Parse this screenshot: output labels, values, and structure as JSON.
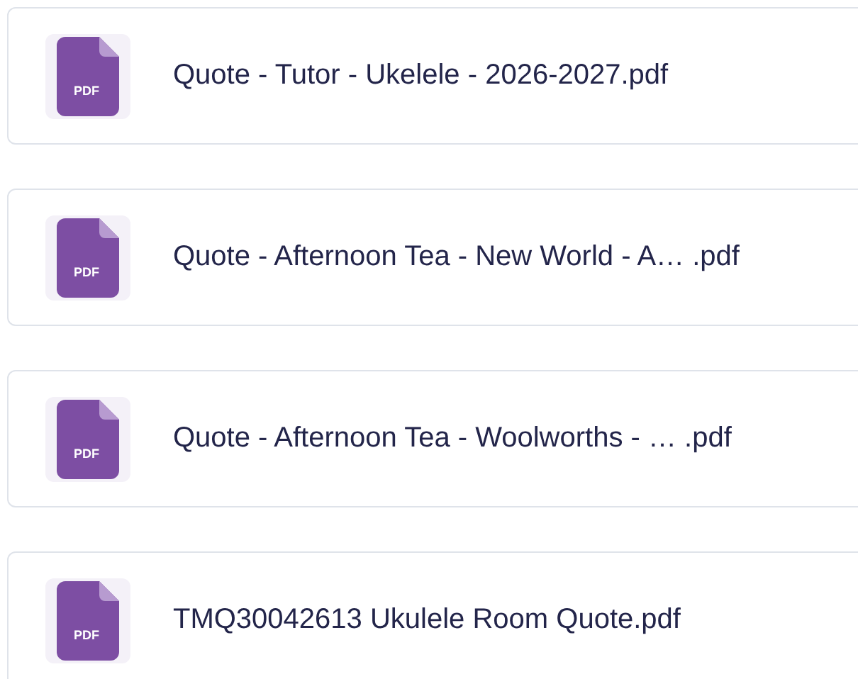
{
  "files": [
    {
      "icon_label": "PDF",
      "name": "Quote - Tutor - Ukelele - 2026-2027.pdf"
    },
    {
      "icon_label": "PDF",
      "name": "Quote - Afternoon Tea - New World - A… .pdf"
    },
    {
      "icon_label": "PDF",
      "name": "Quote - Afternoon Tea - Woolworths - … .pdf"
    },
    {
      "icon_label": "PDF",
      "name": "TMQ30042613 Ukulele Room Quote.pdf"
    }
  ]
}
